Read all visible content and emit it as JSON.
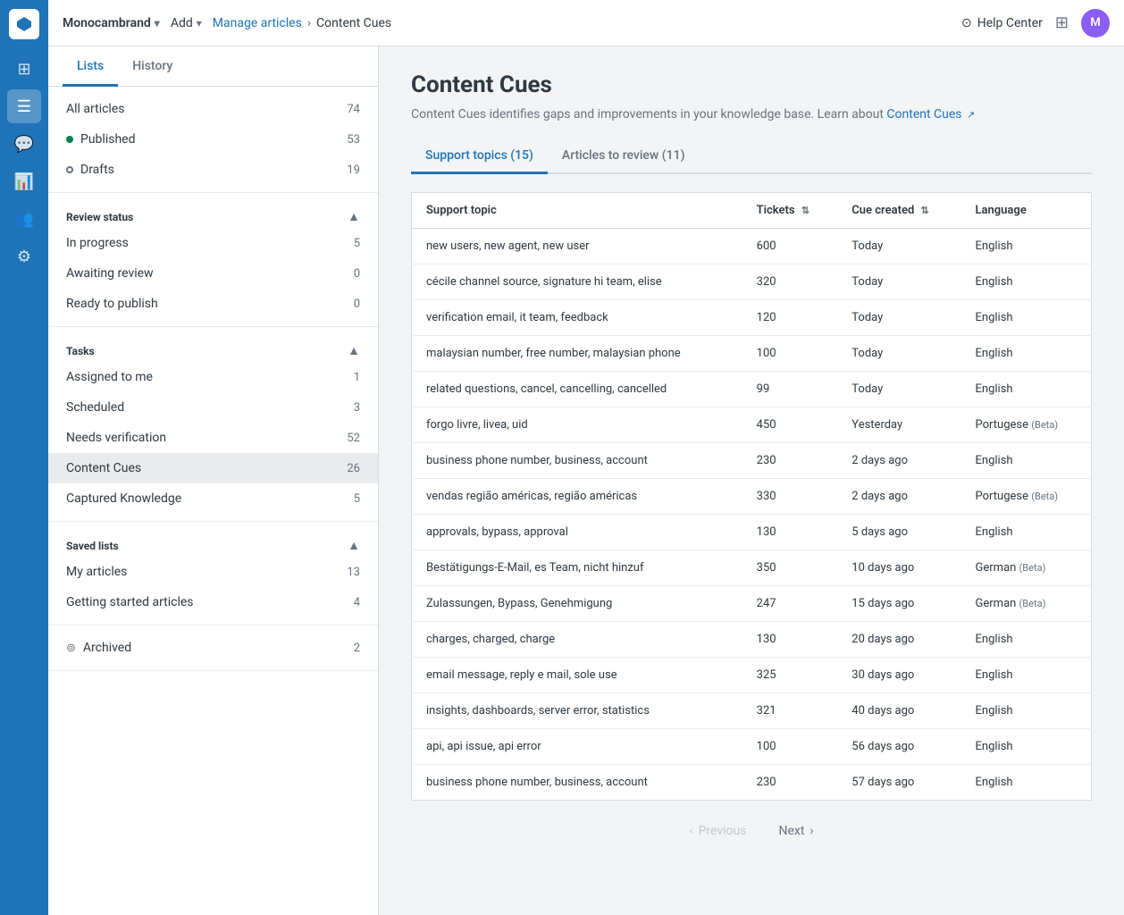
{
  "brand": "Monocambrand",
  "topnav": {
    "add_label": "Add",
    "manage_articles_link": "Manage articles",
    "breadcrumb_current": "Content Cues",
    "help_center_label": "Help Center",
    "avatar_initials": "M"
  },
  "sidebar": {
    "tabs": [
      {
        "id": "lists",
        "label": "Lists",
        "active": true
      },
      {
        "id": "history",
        "label": "History",
        "active": false
      }
    ],
    "articles_section": {
      "rows": [
        {
          "id": "all-articles",
          "label": "All articles",
          "count": 74,
          "dot": null
        },
        {
          "id": "published",
          "label": "Published",
          "count": 53,
          "dot": "green"
        },
        {
          "id": "drafts",
          "label": "Drafts",
          "count": 19,
          "dot": "hollow"
        }
      ]
    },
    "review_status_section": {
      "header": "Review status",
      "expanded": true,
      "rows": [
        {
          "id": "in-progress",
          "label": "In progress",
          "count": 5
        },
        {
          "id": "awaiting-review",
          "label": "Awaiting review",
          "count": 0
        },
        {
          "id": "ready-to-publish",
          "label": "Ready to publish",
          "count": 0
        }
      ]
    },
    "tasks_section": {
      "header": "Tasks",
      "expanded": true,
      "rows": [
        {
          "id": "assigned-to-me",
          "label": "Assigned to me",
          "count": 1
        },
        {
          "id": "scheduled",
          "label": "Scheduled",
          "count": 3
        },
        {
          "id": "needs-verification",
          "label": "Needs verification",
          "count": 52
        },
        {
          "id": "content-cues",
          "label": "Content Cues",
          "count": 26,
          "active": true
        },
        {
          "id": "captured-knowledge",
          "label": "Captured Knowledge",
          "count": 5
        }
      ]
    },
    "saved_lists_section": {
      "header": "Saved lists",
      "expanded": true,
      "rows": [
        {
          "id": "my-articles",
          "label": "My articles",
          "count": 13
        },
        {
          "id": "getting-started",
          "label": "Getting started articles",
          "count": 4
        }
      ]
    },
    "archived_section": {
      "rows": [
        {
          "id": "archived",
          "label": "Archived",
          "count": 2,
          "dot": "archive"
        }
      ]
    }
  },
  "main": {
    "title": "Content Cues",
    "subtitle": "Content Cues identifies gaps and improvements in your knowledge base. Learn about",
    "subtitle_link": "Content Cues",
    "tabs": [
      {
        "id": "support-topics",
        "label": "Support topics (15)",
        "active": true
      },
      {
        "id": "articles-to-review",
        "label": "Articles to review (11)",
        "active": false
      }
    ],
    "table": {
      "columns": [
        {
          "id": "support-topic",
          "label": "Support topic",
          "sortable": false
        },
        {
          "id": "tickets",
          "label": "Tickets",
          "sortable": true
        },
        {
          "id": "cue-created",
          "label": "Cue created",
          "sortable": true
        },
        {
          "id": "language",
          "label": "Language",
          "sortable": false
        }
      ],
      "rows": [
        {
          "topic": "new users, new agent, new user",
          "tickets": 600,
          "cue_created": "Today",
          "language": "English",
          "language_beta": false
        },
        {
          "topic": "cécile channel source, signature hi team, elise",
          "tickets": 320,
          "cue_created": "Today",
          "language": "English",
          "language_beta": false
        },
        {
          "topic": "verification email, it team, feedback",
          "tickets": 120,
          "cue_created": "Today",
          "language": "English",
          "language_beta": false
        },
        {
          "topic": "malaysian number, free number, malaysian phone",
          "tickets": 100,
          "cue_created": "Today",
          "language": "English",
          "language_beta": false
        },
        {
          "topic": "related questions, cancel, cancelling, cancelled",
          "tickets": 99,
          "cue_created": "Today",
          "language": "English",
          "language_beta": false
        },
        {
          "topic": "forgo livre, livea, uid",
          "tickets": 450,
          "cue_created": "Yesterday",
          "language": "Portugese",
          "language_beta": true
        },
        {
          "topic": "business phone number, business, account",
          "tickets": 230,
          "cue_created": "2 days ago",
          "language": "English",
          "language_beta": false
        },
        {
          "topic": "vendas região américas, região américas",
          "tickets": 330,
          "cue_created": "2 days ago",
          "language": "Portugese",
          "language_beta": true
        },
        {
          "topic": "approvals, bypass, approval",
          "tickets": 130,
          "cue_created": "5 days ago",
          "language": "English",
          "language_beta": false
        },
        {
          "topic": "Bestätigungs-E-Mail, es Team, nicht hinzuf",
          "tickets": 350,
          "cue_created": "10 days ago",
          "language": "German",
          "language_beta": true
        },
        {
          "topic": "Zulassungen, Bypass, Genehmigung",
          "tickets": 247,
          "cue_created": "15 days ago",
          "language": "German",
          "language_beta": true
        },
        {
          "topic": "charges, charged, charge",
          "tickets": 130,
          "cue_created": "20 days ago",
          "language": "English",
          "language_beta": false
        },
        {
          "topic": "email message, reply e mail, sole use",
          "tickets": 325,
          "cue_created": "30 days ago",
          "language": "English",
          "language_beta": false
        },
        {
          "topic": "insights, dashboards, server error, statistics",
          "tickets": 321,
          "cue_created": "40 days ago",
          "language": "English",
          "language_beta": false
        },
        {
          "topic": "api, api issue, api error",
          "tickets": 100,
          "cue_created": "56 days ago",
          "language": "English",
          "language_beta": false
        },
        {
          "topic": "business phone number, business, account",
          "tickets": 230,
          "cue_created": "57 days ago",
          "language": "English",
          "language_beta": false
        }
      ]
    },
    "pagination": {
      "previous_label": "Previous",
      "next_label": "Next"
    }
  }
}
